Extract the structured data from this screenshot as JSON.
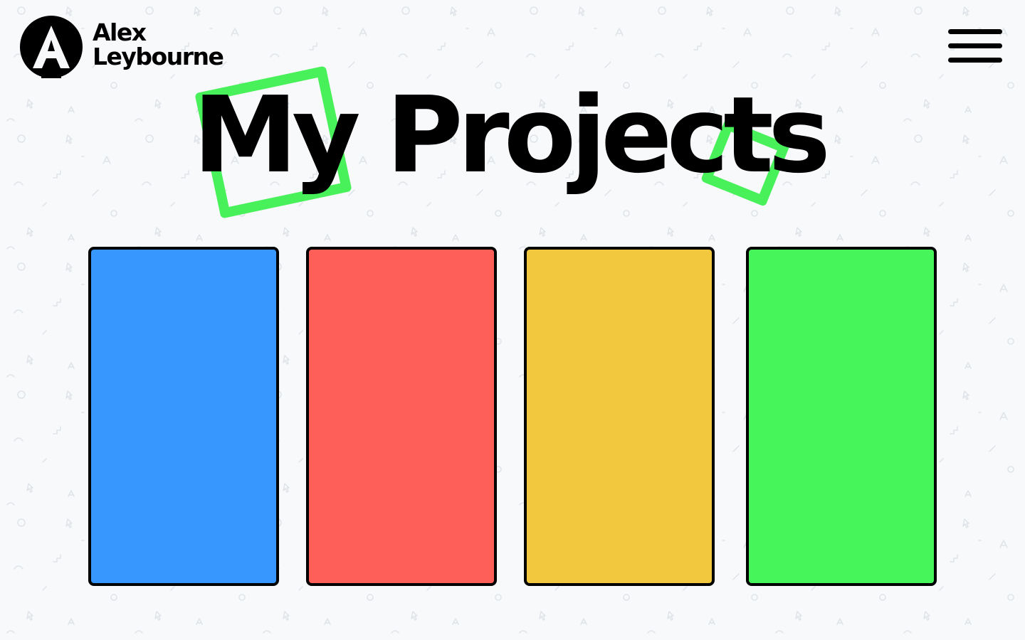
{
  "brand": {
    "name_line1": "Alex",
    "name_line2": "Leybourne",
    "logo_icon": "letter-a-logo-icon"
  },
  "header": {
    "menu_icon": "hamburger-menu-icon"
  },
  "hero": {
    "title": "My Projects",
    "accent_color": "#48f05a"
  },
  "projects": [
    {
      "color": "#3797fe"
    },
    {
      "color": "#fe5f59"
    },
    {
      "color": "#f2c93e"
    },
    {
      "color": "#46f55a"
    }
  ],
  "colors": {
    "background": "#f7f9fb",
    "text": "#000000",
    "card_border": "#000000"
  }
}
